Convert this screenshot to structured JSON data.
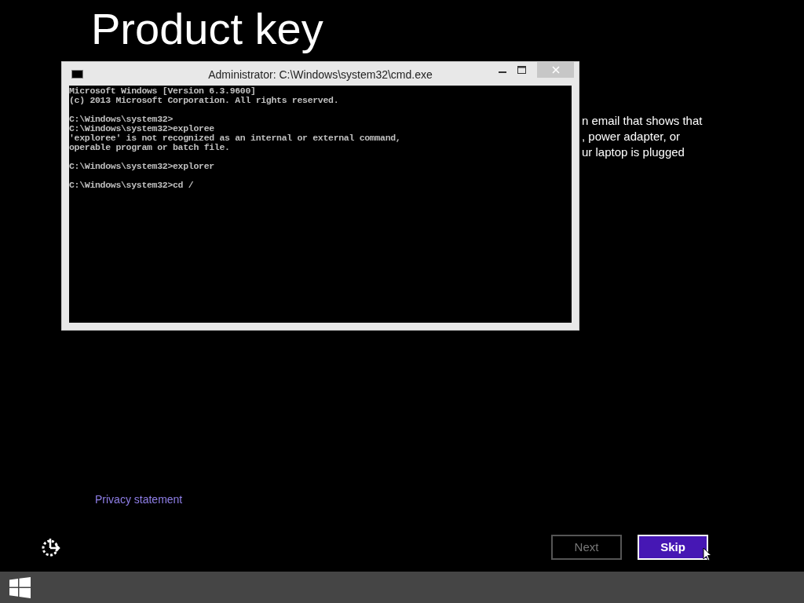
{
  "page": {
    "title": "Product key",
    "description_lines": [
      "n email that shows that",
      ", power adapter, or",
      "ur laptop is plugged"
    ],
    "privacy_link": "Privacy statement"
  },
  "console_window": {
    "title": "Administrator: C:\\Windows\\system32\\cmd.exe",
    "blocks": [
      [
        "Microsoft Windows [Version 6.3.9600]",
        "(c) 2013 Microsoft Corporation. All rights reserved."
      ],
      [
        "C:\\Windows\\system32>",
        "C:\\Windows\\system32>exploree",
        "'exploree' is not recognized as an internal or external command,",
        "operable program or batch file."
      ],
      [
        "C:\\Windows\\system32>explorer"
      ],
      [
        "C:\\Windows\\system32>cd /"
      ]
    ]
  },
  "buttons": [
    {
      "label": "Next",
      "disabled": true
    },
    {
      "label": "Skip",
      "disabled": false
    }
  ]
}
